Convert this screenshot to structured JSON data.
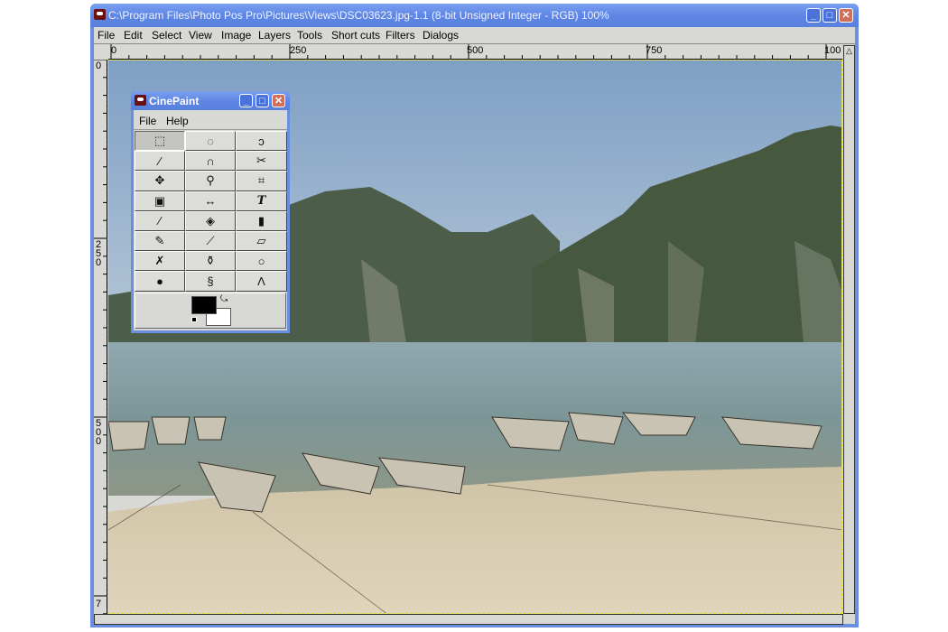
{
  "window": {
    "title": "C:\\Program Files\\Photo Pos Pro\\Pictures\\Views\\DSC03623.jpg-1.1 (8-bit Unsigned Integer - RGB) 100%",
    "min": "_",
    "max": "□",
    "close": "✕"
  },
  "menu": [
    "File",
    "Edit",
    "Select",
    "View",
    "Image",
    "Layers",
    "Tools",
    "Short cuts",
    "Filters",
    "Dialogs"
  ],
  "hruler": [
    "0",
    "250",
    "500",
    "750",
    "100"
  ],
  "vruler": [
    "0",
    "2\n5\n0",
    "5\n0\n0",
    "7"
  ],
  "toolbox": {
    "title": "CinePaint",
    "menu": [
      "File",
      "Help"
    ],
    "tools": [
      {
        "name": "rect-select",
        "glyph": "⬚"
      },
      {
        "name": "ellipse-select",
        "glyph": "◌"
      },
      {
        "name": "free-select",
        "glyph": "ↄ"
      },
      {
        "name": "fuzzy-select",
        "glyph": "⁄"
      },
      {
        "name": "bezier-select",
        "glyph": "∩"
      },
      {
        "name": "intelligent-scissors",
        "glyph": "✂"
      },
      {
        "name": "move",
        "glyph": "✥"
      },
      {
        "name": "magnify",
        "glyph": "⚲"
      },
      {
        "name": "crop",
        "glyph": "⌗"
      },
      {
        "name": "transform",
        "glyph": "▣"
      },
      {
        "name": "flip",
        "glyph": "↔"
      },
      {
        "name": "text",
        "glyph": "T"
      },
      {
        "name": "color-picker",
        "glyph": "⁄"
      },
      {
        "name": "bucket-fill",
        "glyph": "◈"
      },
      {
        "name": "gradient",
        "glyph": "▮"
      },
      {
        "name": "pencil",
        "glyph": "✎"
      },
      {
        "name": "paintbrush",
        "glyph": "⟋"
      },
      {
        "name": "eraser",
        "glyph": "▱"
      },
      {
        "name": "airbrush",
        "glyph": "✗"
      },
      {
        "name": "clone",
        "glyph": "⚱"
      },
      {
        "name": "convolve",
        "glyph": "○"
      },
      {
        "name": "ink",
        "glyph": "●"
      },
      {
        "name": "smudge",
        "glyph": "§"
      },
      {
        "name": "measure",
        "glyph": "Λ"
      }
    ],
    "foreground": "#000000",
    "background": "#ffffff"
  }
}
